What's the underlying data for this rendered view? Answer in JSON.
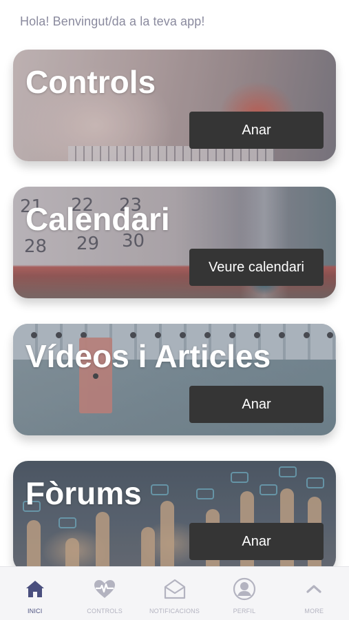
{
  "greeting": "Hola! Benvingut/da a la teva app!",
  "cards": [
    {
      "title": "Controls",
      "button": "Anar"
    },
    {
      "title": "Calendari",
      "button": "Veure calendari"
    },
    {
      "title": "Vídeos i Articles",
      "button": "Anar"
    },
    {
      "title": "Fòrums",
      "button": "Anar"
    }
  ],
  "calendar_numbers": [
    "21",
    "22",
    "23",
    "28",
    "29",
    "30"
  ],
  "nav": [
    {
      "label": "INICI",
      "icon": "home-icon",
      "active": true
    },
    {
      "label": "CONTROLS",
      "icon": "heartbeat-icon",
      "active": false
    },
    {
      "label": "NOTIFICACIONS",
      "icon": "envelope-icon",
      "active": false
    },
    {
      "label": "PERFIL",
      "icon": "user-icon",
      "active": false
    },
    {
      "label": "MORE",
      "icon": "chevron-up-icon",
      "active": false
    }
  ],
  "colors": {
    "nav_active": "#4a4f7e",
    "nav_inactive": "#b3b3c0",
    "button_bg": "#353535",
    "greeting_text": "#8a8a9e"
  }
}
